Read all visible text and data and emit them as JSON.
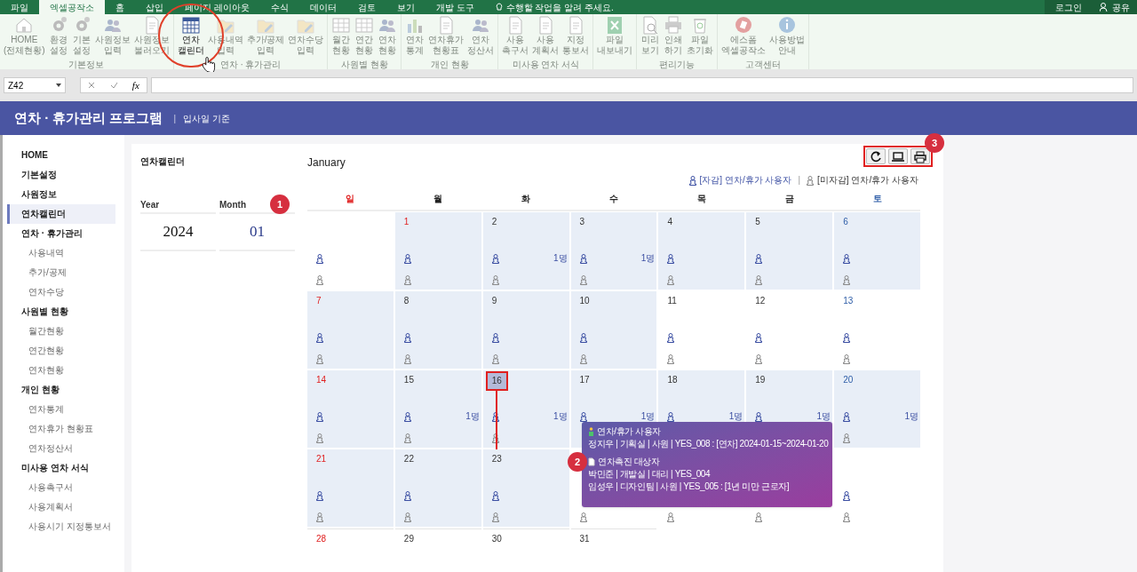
{
  "excel_tabs": [
    {
      "label": "파일",
      "selected": false
    },
    {
      "label": "엑셀공작소",
      "selected": true
    },
    {
      "label": "홈",
      "selected": false
    },
    {
      "label": "삽입",
      "selected": false
    },
    {
      "label": "페이지 레이아웃",
      "selected": false
    },
    {
      "label": "수식",
      "selected": false
    },
    {
      "label": "데이터",
      "selected": false
    },
    {
      "label": "검토",
      "selected": false
    },
    {
      "label": "보기",
      "selected": false
    },
    {
      "label": "개발 도구",
      "selected": false
    }
  ],
  "tell_me": "수행할 작업을 알려 주세요.",
  "account": {
    "login": "로그인",
    "share": "공유"
  },
  "ribbon": {
    "groups": [
      {
        "label": "기본정보",
        "buttons": [
          {
            "lines": [
              "HOME",
              "(전체현황)"
            ],
            "disabled": true
          },
          {
            "lines": [
              "환경",
              "설정"
            ],
            "disabled": true
          },
          {
            "lines": [
              "기본",
              "설정"
            ],
            "disabled": true
          },
          {
            "lines": [
              "사원정보",
              "입력"
            ],
            "disabled": true
          },
          {
            "lines": [
              "사원정보",
              "불러오기"
            ],
            "disabled": true
          }
        ]
      },
      {
        "label": "연차 · 휴가관리",
        "buttons": [
          {
            "lines": [
              "연차",
              "캘린더"
            ],
            "disabled": false
          },
          {
            "lines": [
              "사용내역",
              "입력"
            ],
            "disabled": true
          },
          {
            "lines": [
              "추가/공제",
              "입력"
            ],
            "disabled": true
          },
          {
            "lines": [
              "연차수당",
              "입력"
            ],
            "disabled": true
          }
        ]
      },
      {
        "label": "사원별 현황",
        "buttons": [
          {
            "lines": [
              "월간",
              "현황"
            ],
            "disabled": true
          },
          {
            "lines": [
              "연간",
              "현황"
            ],
            "disabled": true
          },
          {
            "lines": [
              "연차",
              "현황"
            ],
            "disabled": true
          }
        ]
      },
      {
        "label": "개인 현황",
        "buttons": [
          {
            "lines": [
              "연차",
              "통계"
            ],
            "disabled": true
          },
          {
            "lines": [
              "연차휴가",
              "현황표"
            ],
            "disabled": true
          },
          {
            "lines": [
              "연차",
              "정산서"
            ],
            "disabled": true
          }
        ]
      },
      {
        "label": "미사용 연차 서식",
        "buttons": [
          {
            "lines": [
              "사용",
              "촉구서"
            ],
            "disabled": true
          },
          {
            "lines": [
              "사용",
              "계획서"
            ],
            "disabled": true
          },
          {
            "lines": [
              "지정",
              "통보서"
            ],
            "disabled": true
          }
        ]
      },
      {
        "buttons": [
          {
            "lines": [
              "파일",
              "내보내기"
            ],
            "disabled": true
          }
        ]
      },
      {
        "label": "편리기능",
        "buttons": [
          {
            "lines": [
              "미리",
              "보기"
            ],
            "disabled": true
          },
          {
            "lines": [
              "인쇄",
              "하기"
            ],
            "disabled": true
          },
          {
            "lines": [
              "파일",
              "초기화"
            ],
            "disabled": true
          }
        ]
      },
      {
        "label": "고객센터",
        "buttons": [
          {
            "lines": [
              "에스폼",
              "엑셀공작소"
            ],
            "disabled": true
          },
          {
            "lines": [
              "사용방법",
              "안내"
            ],
            "disabled": true
          }
        ]
      }
    ]
  },
  "formula_bar": {
    "name_box": "Z42",
    "function_label": "fx"
  },
  "app": {
    "title": "연차 · 휴가관리 프로그램",
    "separator": "|",
    "subtitle": "입사일 기준"
  },
  "sidebar": {
    "items": [
      {
        "label": "HOME",
        "selected": false
      },
      {
        "label": "기본설정",
        "selected": false
      },
      {
        "label": "사원정보",
        "selected": false
      },
      {
        "label": "연차캘린더",
        "selected": true
      },
      {
        "label": "연차 · 휴가관리",
        "selected": false,
        "children": [
          {
            "label": "사용내역",
            "selected": false
          },
          {
            "label": "추가/공제",
            "selected": false
          },
          {
            "label": "연차수당",
            "selected": false
          }
        ]
      },
      {
        "label": "사원별 현황",
        "selected": false,
        "children": [
          {
            "label": "월간현황",
            "selected": false
          },
          {
            "label": "연간현황",
            "selected": false
          },
          {
            "label": "연차현황",
            "selected": false
          }
        ]
      },
      {
        "label": "개인 현황",
        "selected": false,
        "children": [
          {
            "label": "연차통계",
            "selected": false
          },
          {
            "label": "연차휴가 현황표",
            "selected": false
          },
          {
            "label": "연차정산서",
            "selected": false
          }
        ]
      },
      {
        "label": "미사용 연차 서식",
        "selected": false,
        "children": [
          {
            "label": "사용촉구서",
            "selected": false
          },
          {
            "label": "사용계획서",
            "selected": false
          },
          {
            "label": "사용시기 지정통보서",
            "selected": false
          }
        ]
      }
    ]
  },
  "panel": {
    "title": "연차캘린더",
    "year_label": "Year",
    "month_label": "Month",
    "year": "2024",
    "month": "01"
  },
  "calendar": {
    "month": "January",
    "legend": [
      {
        "label": "[자감] 연차/휴가 사용자",
        "kind": "deducted"
      },
      {
        "label": "[미자감] 연차/휴가 사용자",
        "kind": "undeducted"
      }
    ],
    "legend_separator": "|",
    "weekdays": [
      "일",
      "월",
      "화",
      "수",
      "목",
      "금",
      "토"
    ],
    "weeks": [
      [
        {
          "shaded": false,
          "markers": true,
          "selected": false
        },
        {
          "day": "1",
          "shaded": true,
          "markers": true,
          "holiday": true,
          "selected": false
        },
        {
          "day": "2",
          "shaded": true,
          "markers": true,
          "holiday": false,
          "selected": false,
          "count": "1명"
        },
        {
          "day": "3",
          "shaded": true,
          "markers": true,
          "holiday": false,
          "selected": false,
          "count": "1명"
        },
        {
          "day": "4",
          "shaded": true,
          "markers": true,
          "holiday": false,
          "selected": false
        },
        {
          "day": "5",
          "shaded": true,
          "markers": true,
          "holiday": false,
          "selected": false
        },
        {
          "day": "6",
          "shaded": true,
          "markers": true,
          "holiday": false,
          "selected": false
        }
      ],
      [
        {
          "day": "7",
          "shaded": true,
          "markers": true,
          "holiday": true,
          "selected": false
        },
        {
          "day": "8",
          "shaded": true,
          "markers": true,
          "holiday": false,
          "selected": false
        },
        {
          "day": "9",
          "shaded": true,
          "markers": true,
          "holiday": false,
          "selected": false
        },
        {
          "day": "10",
          "shaded": true,
          "markers": true,
          "holiday": false,
          "selected": false
        },
        {
          "day": "11",
          "shaded": false,
          "markers": true,
          "holiday": false,
          "selected": false
        },
        {
          "day": "12",
          "shaded": false,
          "markers": true,
          "holiday": false,
          "selected": false
        },
        {
          "day": "13",
          "shaded": false,
          "markers": true,
          "holiday": false,
          "selected": false
        }
      ],
      [
        {
          "day": "14",
          "shaded": true,
          "markers": true,
          "holiday": true,
          "selected": false
        },
        {
          "day": "15",
          "shaded": true,
          "markers": true,
          "holiday": false,
          "selected": false,
          "count": "1명"
        },
        {
          "day": "16",
          "shaded": true,
          "markers": true,
          "holiday": false,
          "selected": true,
          "count": "1명"
        },
        {
          "day": "17",
          "shaded": true,
          "markers": true,
          "undeducted_marker": false,
          "holiday": false,
          "selected": false,
          "count": "1명"
        },
        {
          "day": "18",
          "shaded": true,
          "markers": true,
          "undeducted_marker": false,
          "holiday": false,
          "selected": false,
          "count": "1명"
        },
        {
          "day": "19",
          "shaded": true,
          "markers": true,
          "holiday": false,
          "selected": false,
          "count": "1명"
        },
        {
          "day": "20",
          "shaded": true,
          "markers": true,
          "holiday": false,
          "selected": false,
          "count": "1명"
        }
      ],
      [
        {
          "day": "21",
          "shaded": true,
          "markers": true,
          "holiday": true,
          "selected": false
        },
        {
          "day": "22",
          "shaded": true,
          "markers": true,
          "holiday": false,
          "selected": false
        },
        {
          "day": "23",
          "shaded": true,
          "markers": true,
          "holiday": false,
          "selected": false
        },
        {
          "shaded": false,
          "markers": true,
          "deducted_marker": false,
          "selected": false
        },
        {
          "shaded": false,
          "markers": true,
          "deducted_marker": false,
          "selected": false
        },
        {
          "shaded": false,
          "markers": true,
          "selected": false
        },
        {
          "shaded": false,
          "markers": true,
          "selected": false
        }
      ],
      [
        {
          "day": "28",
          "shaded": false,
          "markers": false,
          "holiday": true,
          "selected": false
        },
        {
          "day": "29",
          "shaded": false,
          "markers": false,
          "holiday": false,
          "selected": false
        },
        {
          "day": "30",
          "shaded": false,
          "markers": false,
          "holiday": false,
          "selected": false
        },
        {
          "day": "31",
          "shaded": false,
          "markers": false,
          "holiday": false,
          "selected": false
        }
      ]
    ]
  },
  "tooltip": {
    "sections": [
      {
        "kind": "users",
        "heading": "연차/휴가 사용자",
        "lines": [
          "정지우 | 기획실 | 사원 | YES_008 : [연차] 2024-01-15~2024-01-20"
        ]
      },
      {
        "kind": "targets",
        "heading": "연차촉진 대상자",
        "lines": [
          "박민준 | 개발실 | 대리 | YES_004",
          "임성우 | 디자인팀 | 사원 | YES_005 : [1년 미만 근로자]"
        ]
      }
    ]
  },
  "callouts": [
    "1",
    "2",
    "3"
  ]
}
